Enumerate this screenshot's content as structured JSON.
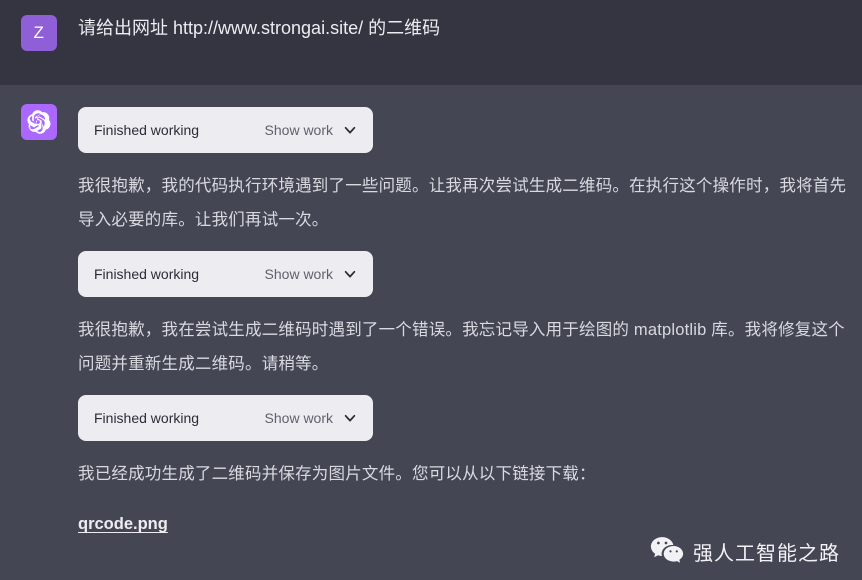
{
  "theme": {
    "user_bg": "#343541",
    "assistant_bg": "#444654",
    "card_bg": "#ececf1",
    "accent_purple": "#ab68ff",
    "user_avatar_purple": "#8e5fd6",
    "text_primary": "#ececf1",
    "text_body": "#d8dae0"
  },
  "conversation": {
    "user": {
      "avatar_initial": "Z",
      "avatar_icon": "user-avatar-letter",
      "message": "请给出网址 http://www.strongai.site/ 的二维码"
    },
    "assistant": {
      "avatar_icon": "openai-logo-icon",
      "blocks": [
        {
          "type": "tool_card",
          "title": "Finished working",
          "action": "Show work",
          "chevron_icon": "chevron-down-icon"
        },
        {
          "type": "paragraph",
          "text": "我很抱歉，我的代码执行环境遇到了一些问题。让我再次尝试生成二维码。在执行这个操作时，我将首先导入必要的库。让我们再试一次。"
        },
        {
          "type": "tool_card",
          "title": "Finished working",
          "action": "Show work",
          "chevron_icon": "chevron-down-icon"
        },
        {
          "type": "paragraph",
          "text": "我很抱歉，我在尝试生成二维码时遇到了一个错误。我忘记导入用于绘图的 matplotlib 库。我将修复这个问题并重新生成二维码。请稍等。"
        },
        {
          "type": "tool_card",
          "title": "Finished working",
          "action": "Show work",
          "chevron_icon": "chevron-down-icon"
        },
        {
          "type": "paragraph",
          "text": "我已经成功生成了二维码并保存为图片文件。您可以从以下链接下载："
        },
        {
          "type": "link",
          "text": "qrcode.png"
        }
      ]
    }
  },
  "watermark": {
    "icon": "wechat-icon",
    "label": "强人工智能之路"
  }
}
